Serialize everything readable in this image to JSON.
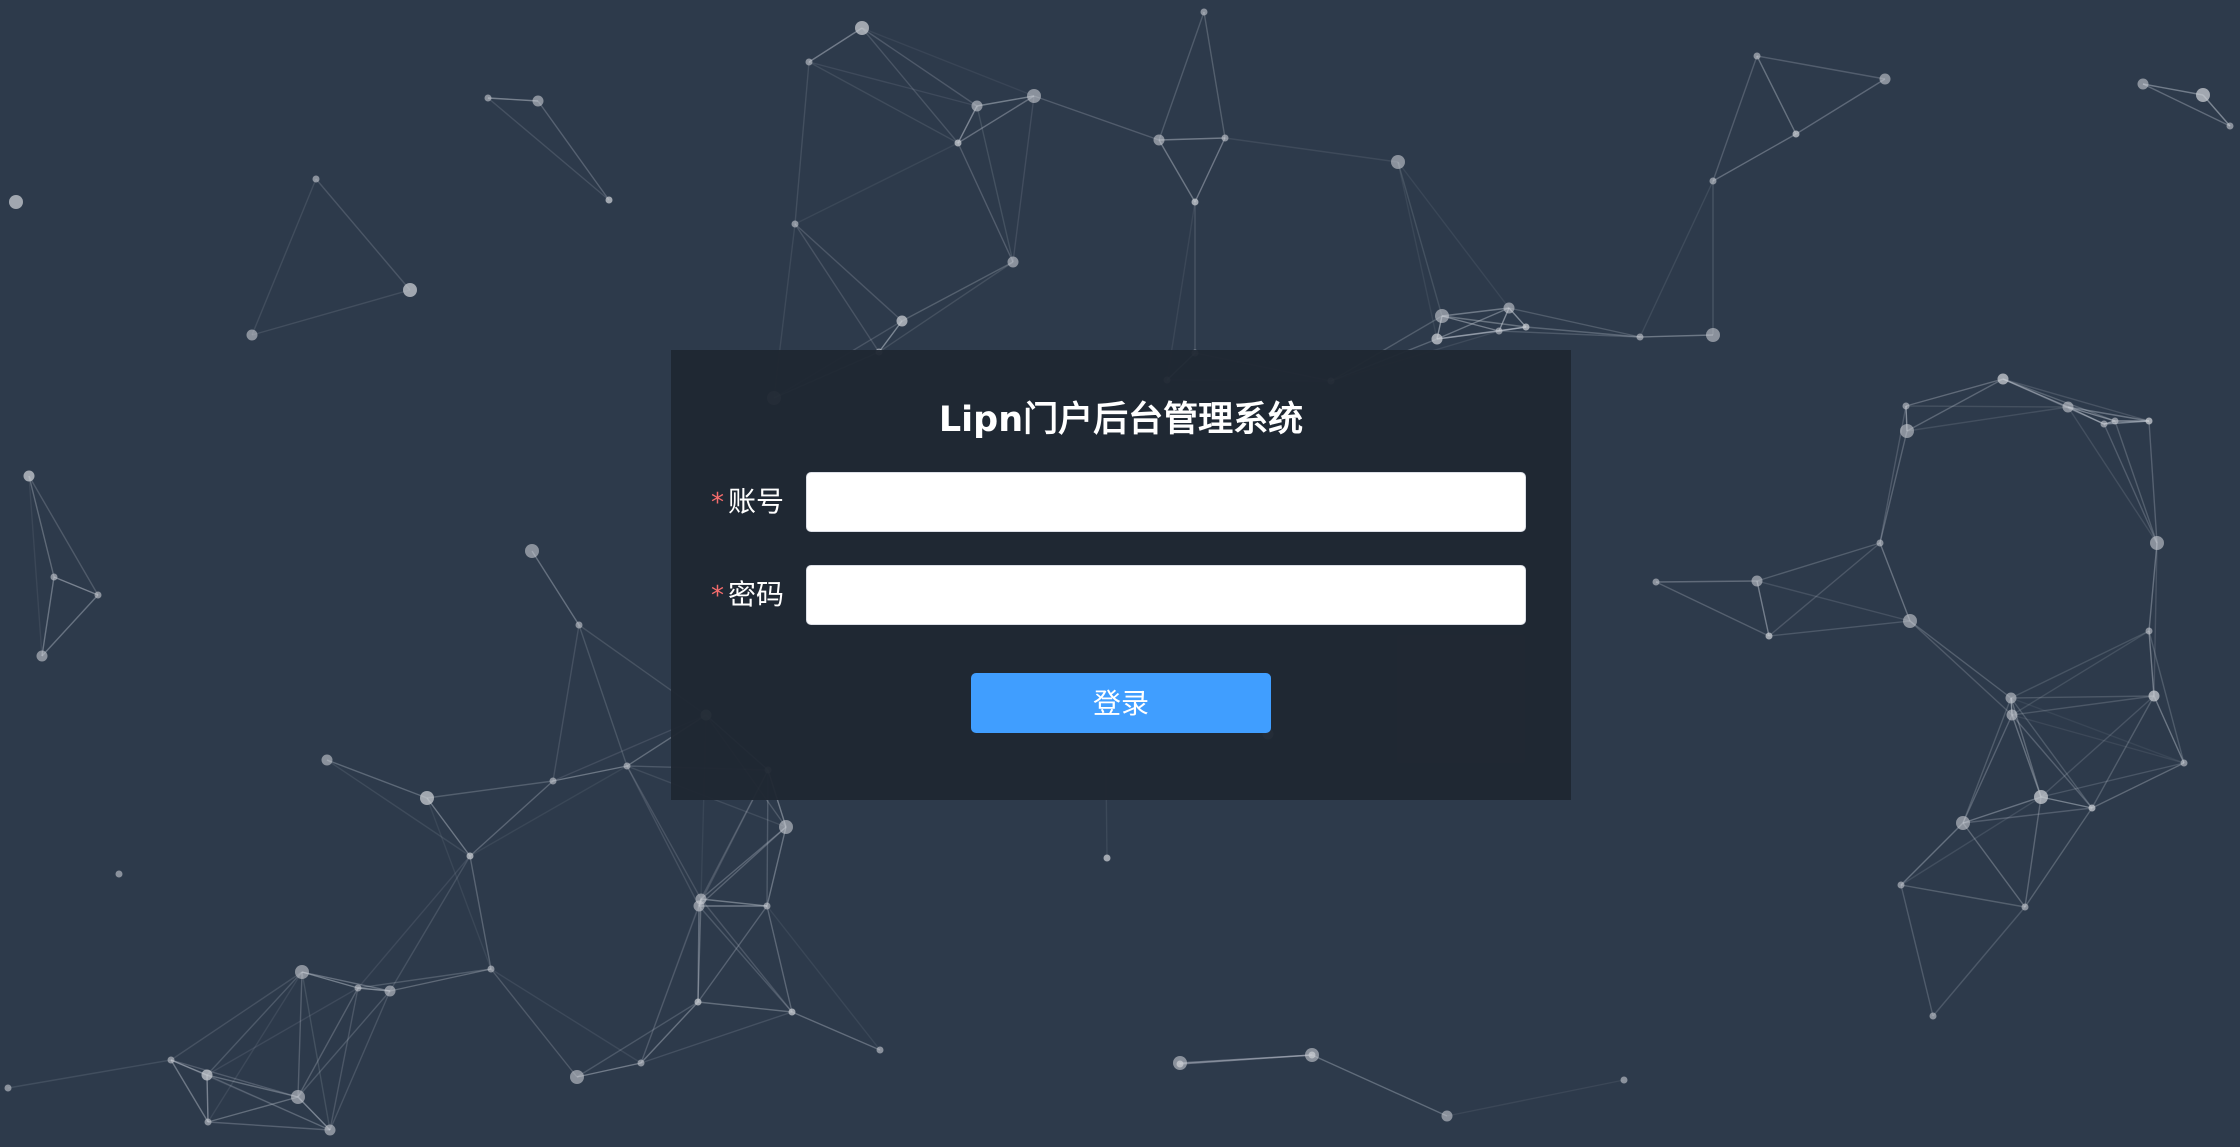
{
  "login": {
    "title": "Lipn门户后台管理系统",
    "required_mark": "*",
    "account_label": "账号",
    "account_value": "",
    "password_label": "密码",
    "password_value": "",
    "submit_label": "登录"
  },
  "colors": {
    "background": "#2d3a4b",
    "panel": "#1f2732",
    "primary_button": "#409eff",
    "required_mark": "#f56c6c",
    "network_lines": "#c7ced8",
    "network_nodes": "#c8ccd2"
  }
}
